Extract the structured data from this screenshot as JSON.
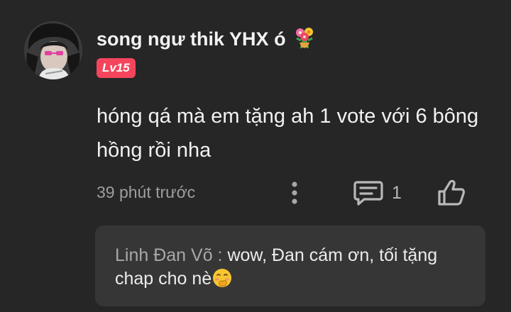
{
  "comment": {
    "username": "song ngư thik YHX ó",
    "username_emoji": "bouquet-icon",
    "level": "Lv15",
    "text": "hóng qá mà em tặng ah 1 vote với 6 bông hồng rồi nha",
    "timestamp": "39 phút trước",
    "reply_count": "1"
  },
  "reply": {
    "author": "Linh Đan Võ : ",
    "text": "wow, Đan cám ơn, tối tặng chap cho nè",
    "emoji": "giggle-emoji-icon"
  },
  "colors": {
    "background": "#262626",
    "badge": "#f5455c",
    "reply_box": "#363636",
    "text_primary": "#f2f2f2",
    "text_secondary": "#9e9e9e"
  }
}
